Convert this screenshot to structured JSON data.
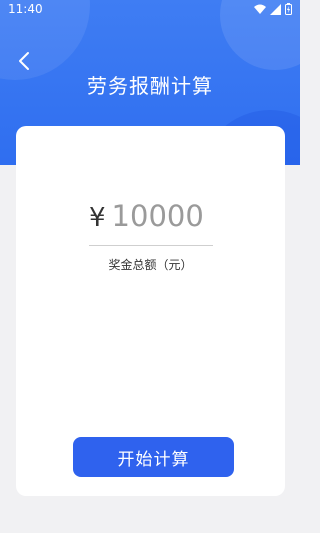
{
  "status_bar": {
    "time": "11:40",
    "icons": [
      "wifi-icon",
      "signal-icon",
      "battery-icon"
    ]
  },
  "header": {
    "title": "劳务报酬计算",
    "back_icon": "chevron-left-icon",
    "color": "#3f7df3"
  },
  "form": {
    "currency_symbol": "¥",
    "amount_placeholder": "10000",
    "amount_value": "",
    "amount_label": "奖金总额（元）"
  },
  "actions": {
    "calculate_label": "开始计算",
    "button_color": "#2f62ee"
  }
}
